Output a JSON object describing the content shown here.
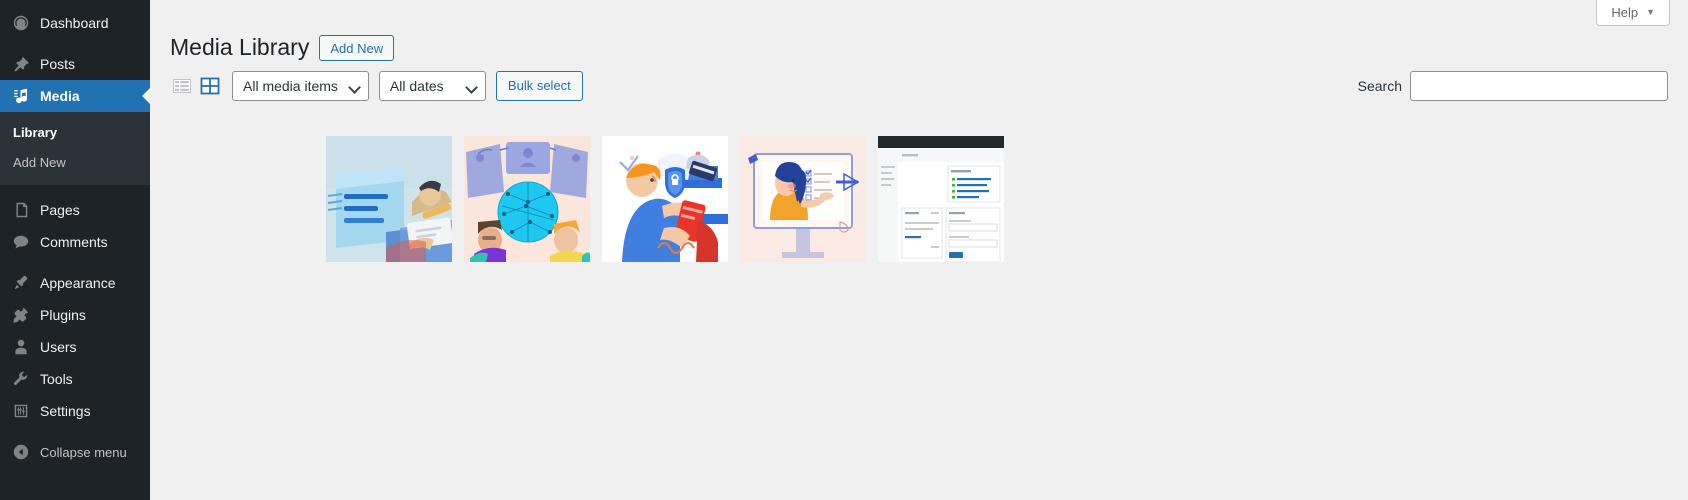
{
  "sidebar": {
    "items": [
      {
        "label": "Dashboard",
        "icon": "dashboard-icon",
        "current": false
      },
      {
        "label": "Posts",
        "icon": "pin-icon",
        "current": false
      },
      {
        "label": "Media",
        "icon": "media-icon",
        "current": true
      },
      {
        "label": "Pages",
        "icon": "page-icon",
        "current": false
      },
      {
        "label": "Comments",
        "icon": "comments-icon",
        "current": false
      },
      {
        "label": "Appearance",
        "icon": "brush-icon",
        "current": false
      },
      {
        "label": "Plugins",
        "icon": "plugin-icon",
        "current": false
      },
      {
        "label": "Users",
        "icon": "user-icon",
        "current": false
      },
      {
        "label": "Tools",
        "icon": "wrench-icon",
        "current": false
      },
      {
        "label": "Settings",
        "icon": "settings-icon",
        "current": false
      }
    ],
    "media_submenu": [
      {
        "label": "Library",
        "current": true
      },
      {
        "label": "Add New",
        "current": false
      }
    ],
    "collapse": {
      "label": "Collapse menu",
      "icon": "collapse-arrow-icon"
    }
  },
  "screen_meta": {
    "help_label": "Help",
    "help_caret": "▼"
  },
  "page": {
    "title": "Media Library",
    "add_new_label": "Add New"
  },
  "toolbar": {
    "view_list_title": "List view",
    "view_grid_title": "Grid view",
    "media_filter_value": "All media items",
    "date_filter_value": "All dates",
    "bulk_select_label": "Bulk select",
    "search_label": "Search",
    "search_value": "",
    "search_placeholder": ""
  },
  "media": {
    "items": [
      {
        "name": "illustration-workspace-blue",
        "alt": "Person at a blue desk working on documents"
      },
      {
        "name": "illustration-video-conference-network",
        "alt": "Video conference with glowing network globe"
      },
      {
        "name": "illustration-secure-payment",
        "alt": "Man making a secure card payment with shield and lock"
      },
      {
        "name": "illustration-woman-presenting-monitor",
        "alt": "Woman with blue hair presenting on a monitor"
      },
      {
        "name": "screenshot-wordpress-dashboard",
        "alt": "Screenshot of a WordPress admin dashboard"
      }
    ]
  },
  "colors": {
    "admin_bg": "#1d2327",
    "submenu_bg": "#2c3338",
    "accent": "#2271b1",
    "body_bg": "#f0f0f1",
    "text": "#1d2327"
  }
}
